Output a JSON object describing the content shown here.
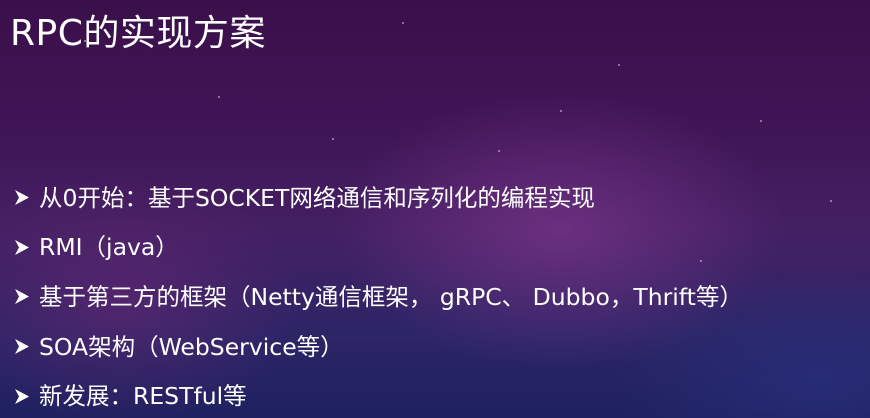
{
  "slide": {
    "title": "RPC的实现方案",
    "bullets": [
      {
        "icon": "arrow-bullet-icon",
        "text": "从0开始：基于SOCKET网络通信和序列化的编程实现"
      },
      {
        "icon": "arrow-bullet-icon",
        "text": "RMI（java）"
      },
      {
        "icon": "arrow-bullet-icon",
        "text": "基于第三方的框架（Netty通信框架， gRPC、 Dubbo，Thrift等）"
      },
      {
        "icon": "arrow-bullet-icon",
        "text": "SOA架构（WebService等）"
      },
      {
        "icon": "arrow-bullet-icon",
        "text": "新发展：RESTful等"
      }
    ]
  },
  "colors": {
    "background_top": "#3a0f4a",
    "background_bottom": "#1f2160",
    "text": "#ffffff"
  }
}
